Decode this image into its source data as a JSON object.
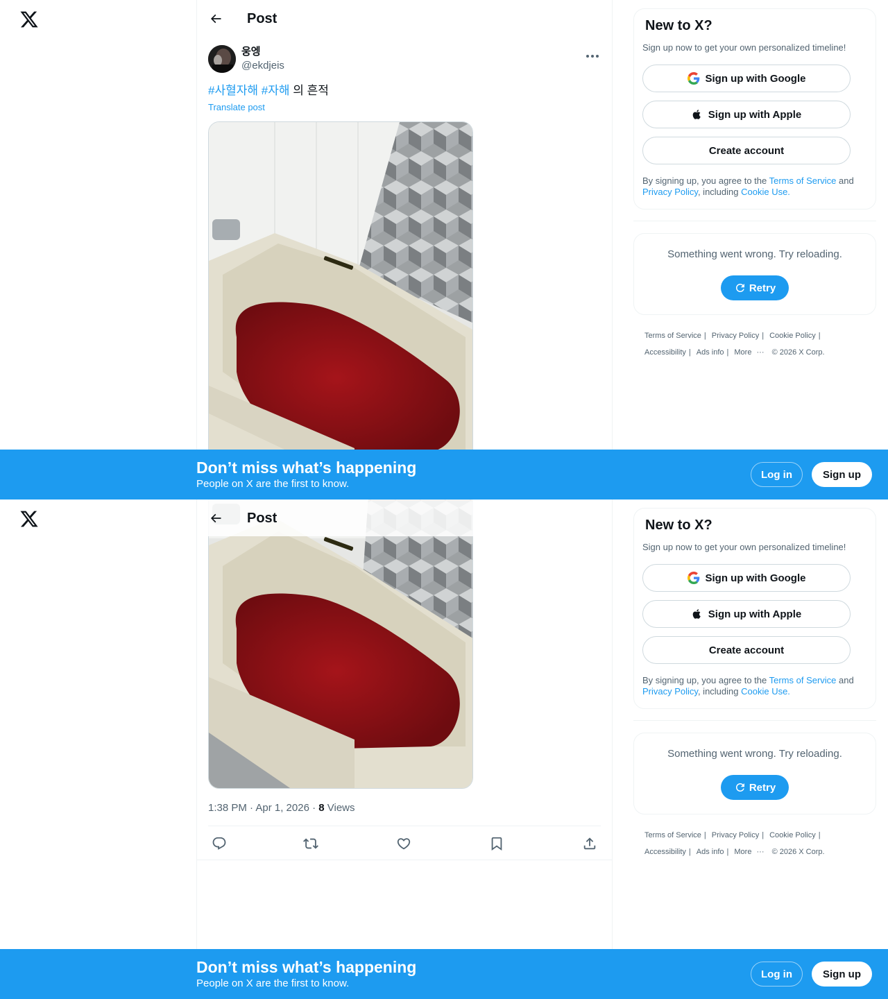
{
  "header": {
    "title": "Post"
  },
  "post": {
    "display_name": "웅엥",
    "handle": "@ekdjeis",
    "hashtag1": "#사혈자해",
    "hashtag2": "#자해",
    "text_rest": " 의 흔적",
    "translate": "Translate post",
    "time": "1:38 PM · Apr 1, 2026 · ",
    "views_count": "8",
    "views_label": " Views"
  },
  "signup_card": {
    "title": "New to X?",
    "subtitle": "Sign up now to get your own personalized timeline!",
    "google": "Sign up with Google",
    "apple": "Sign up with Apple",
    "create": "Create account",
    "legal_pre": "By signing up, you agree to the ",
    "tos": "Terms of Service",
    "and": " and ",
    "privacy": "Privacy Policy",
    "including": ", including ",
    "cookie": "Cookie Use."
  },
  "error_card": {
    "message": "Something went wrong. Try reloading.",
    "retry": "Retry"
  },
  "footer": {
    "tos": "Terms of Service",
    "privacy": "Privacy Policy",
    "cookie": "Cookie Policy",
    "accessibility": "Accessibility",
    "ads": "Ads info",
    "more": "More",
    "copyright": "© 2026 X Corp.",
    "pipe": "|"
  },
  "banner": {
    "title": "Don’t miss what’s happening",
    "subtitle": "People on X are the first to know.",
    "login": "Log in",
    "signup": "Sign up"
  },
  "colors": {
    "accent": "#1d9bf0",
    "text": "#0f1419",
    "muted": "#536471",
    "blood": "#8f1212"
  },
  "icons": [
    "x-logo-icon",
    "back-arrow-icon",
    "more-icon",
    "reply-icon",
    "repost-icon",
    "like-icon",
    "bookmark-icon",
    "share-icon",
    "google-icon",
    "apple-icon",
    "refresh-icon"
  ]
}
